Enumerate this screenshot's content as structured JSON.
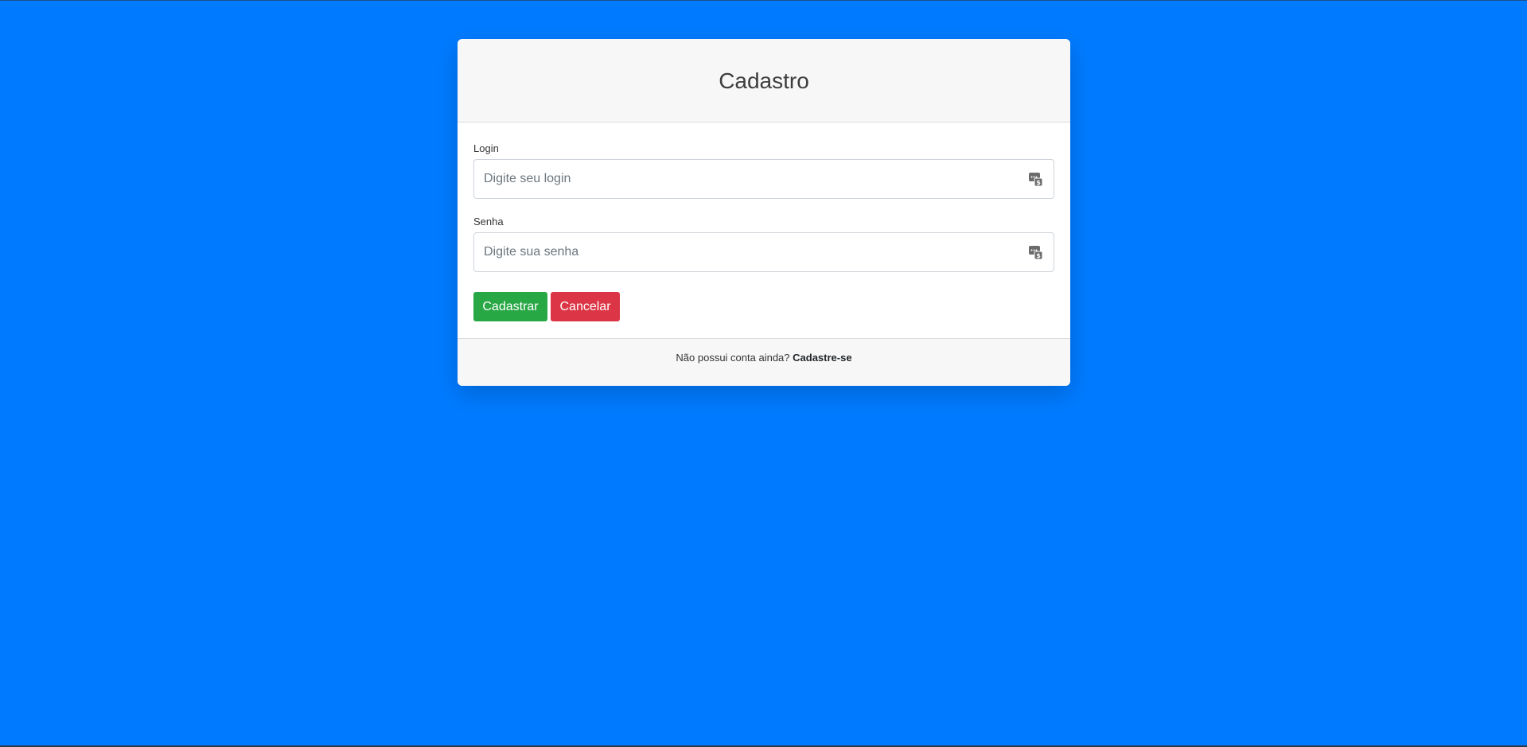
{
  "colors": {
    "background": "#007bff",
    "success": "#28a745",
    "danger": "#dc3545"
  },
  "header": {
    "title": "Cadastro"
  },
  "form": {
    "login": {
      "label": "Login",
      "placeholder": "Digite seu login",
      "value": "",
      "icon": "password-manager-icon"
    },
    "senha": {
      "label": "Senha",
      "placeholder": "Digite sua senha",
      "value": "",
      "icon": "password-manager-icon"
    }
  },
  "buttons": {
    "submit_label": "Cadastrar",
    "cancel_label": "Cancelar"
  },
  "footer": {
    "prompt": "Não possui conta ainda?",
    "link_label": "Cadastre-se"
  }
}
